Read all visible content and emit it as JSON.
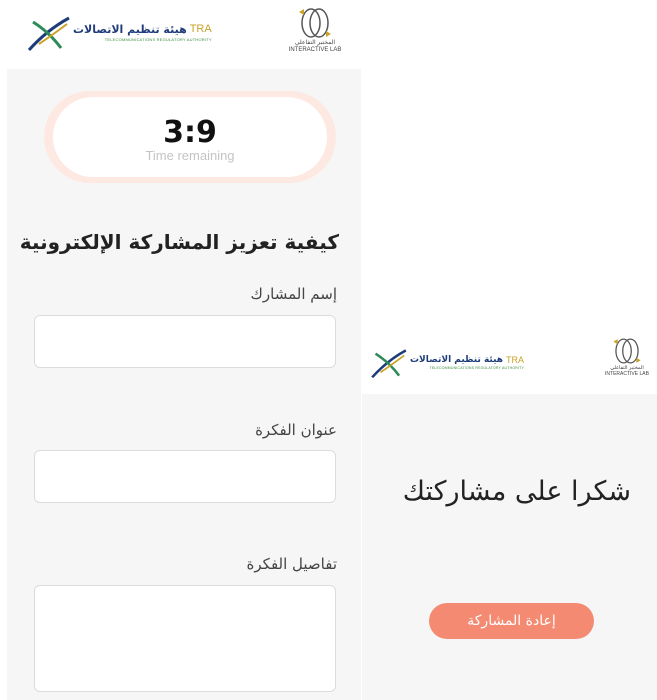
{
  "brand": {
    "tra_arabic": "هيئة تنظيم الاتصالات",
    "tra_abbrev": "TRA",
    "tra_english": "TELECOMMUNICATIONS REGULATORY AUTHORITY",
    "lab_arabic": "المختبر التفاعلي",
    "lab_english": "INTERACTIVE LAB"
  },
  "timer": {
    "value": "3:9",
    "label": "Time remaining"
  },
  "form": {
    "title": "كيفية تعزيز المشاركة الإلكترونية",
    "fields": [
      {
        "label": "إسم المشارك",
        "value": ""
      },
      {
        "label": "عنوان الفكرة",
        "value": ""
      },
      {
        "label": "تفاصيل الفكرة",
        "value": ""
      }
    ]
  },
  "confirmation": {
    "message": "شكرا على مشاركتك",
    "button_label": "إعادة المشاركة"
  },
  "colors": {
    "accent": "#f58a73",
    "timer_ring": "#fde9e2",
    "background": "#f6f6f6"
  }
}
